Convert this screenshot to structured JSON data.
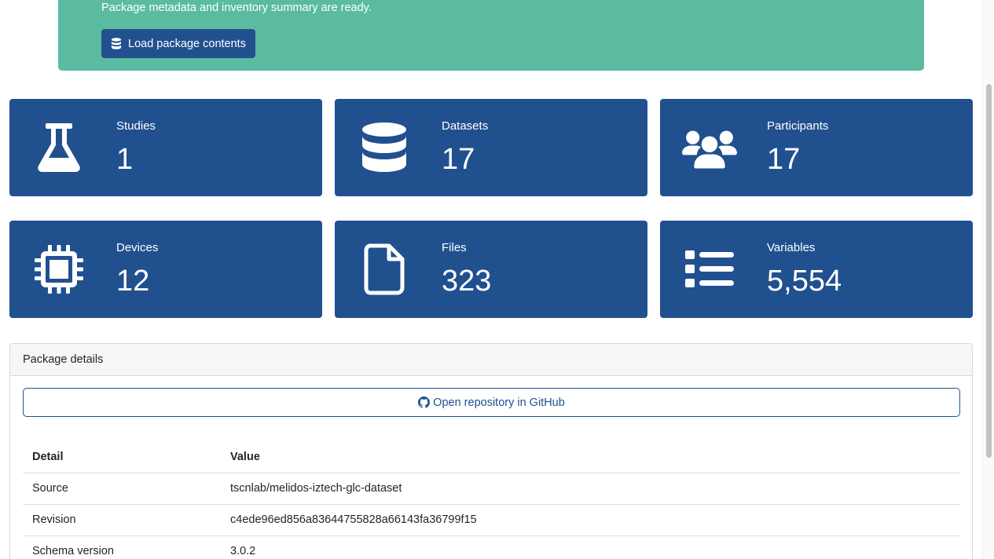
{
  "alert": {
    "message": "Package metadata and inventory summary are ready.",
    "load_button_label": "Load package contents"
  },
  "stats": [
    {
      "label": "Studies",
      "value": "1",
      "icon": "flask-icon"
    },
    {
      "label": "Datasets",
      "value": "17",
      "icon": "database-icon"
    },
    {
      "label": "Participants",
      "value": "17",
      "icon": "users-icon"
    },
    {
      "label": "Devices",
      "value": "12",
      "icon": "microchip-icon"
    },
    {
      "label": "Files",
      "value": "323",
      "icon": "file-icon"
    },
    {
      "label": "Variables",
      "value": "5,554",
      "icon": "list-icon"
    }
  ],
  "package": {
    "header": "Package details",
    "github_button_label": "Open repository in GitHub",
    "columns": [
      "Detail",
      "Value"
    ],
    "rows": [
      [
        "Source",
        "tscnlab/melidos-iztech-glc-dataset"
      ],
      [
        "Revision",
        "c4ede96ed856a83644755828a66143fa36799f15"
      ],
      [
        "Schema version",
        "3.0.2"
      ]
    ]
  },
  "colors": {
    "alert_bg": "#5bbba0",
    "primary": "#21508f"
  }
}
